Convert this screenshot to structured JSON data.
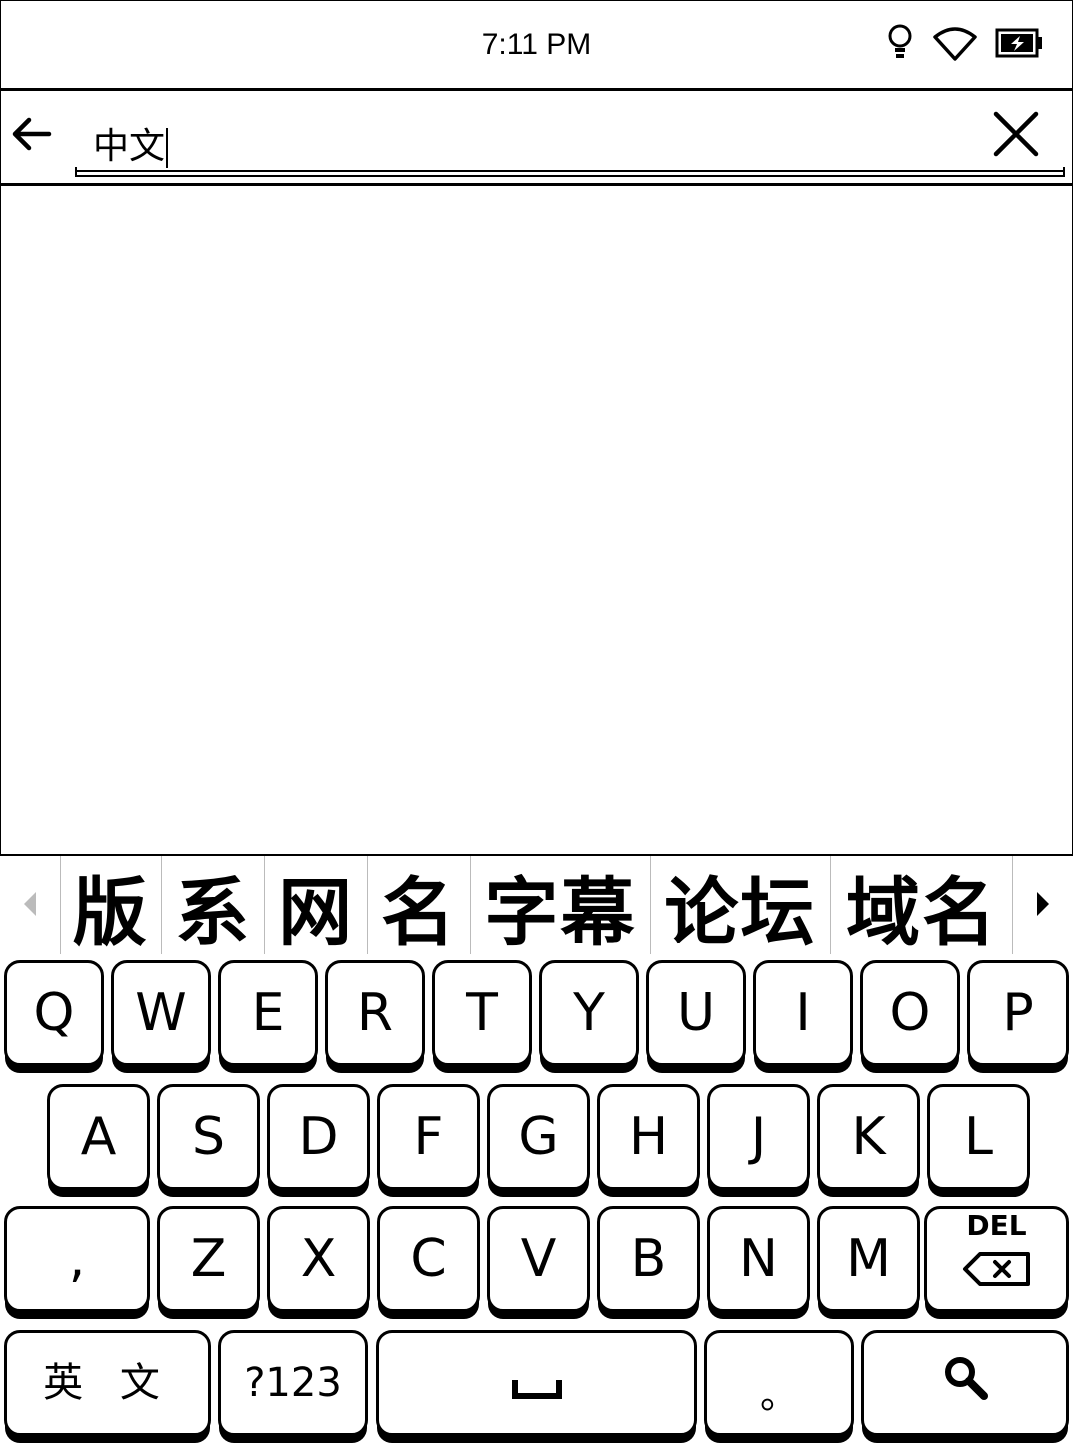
{
  "status_bar": {
    "time": "7:11 PM",
    "icons": [
      "light-bulb-icon",
      "wifi-icon",
      "battery-charging-icon"
    ]
  },
  "search": {
    "query": "中文",
    "icons": {
      "back": "arrow-left-icon",
      "clear": "close-icon"
    }
  },
  "suggestions": {
    "items": [
      "版",
      "系",
      "网",
      "名",
      "字幕",
      "论坛",
      "域名"
    ],
    "icons": {
      "prev": "triangle-left-icon",
      "next": "triangle-right-icon"
    }
  },
  "keyboard": {
    "row1": [
      "Q",
      "W",
      "E",
      "R",
      "T",
      "Y",
      "U",
      "I",
      "O",
      "P"
    ],
    "row2": [
      "A",
      "S",
      "D",
      "F",
      "G",
      "H",
      "J",
      "K",
      "L"
    ],
    "row3": [
      ",",
      "Z",
      "X",
      "C",
      "V",
      "B",
      "N",
      "M"
    ],
    "del_label": "DEL",
    "lang_label": "英 文",
    "symbols_label": "?123",
    "period_label": "。",
    "icons": {
      "space": "space-bar-icon",
      "search": "search-icon",
      "delete": "backspace-icon"
    }
  }
}
